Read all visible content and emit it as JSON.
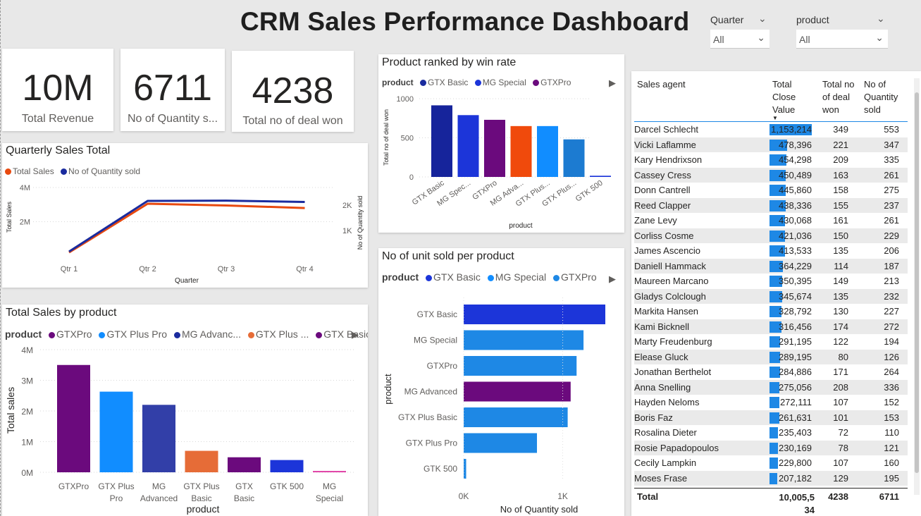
{
  "dashboard": {
    "title": "CRM Sales Performance Dashboard"
  },
  "filters": {
    "quarter": {
      "label": "Quarter",
      "value": "All"
    },
    "product": {
      "label": "product",
      "value": "All"
    }
  },
  "kpis": [
    {
      "value": "10M",
      "label": "Total Revenue"
    },
    {
      "value": "6711",
      "label": "No of Quantity s..."
    },
    {
      "value": "4238",
      "label": "Total no of deal won"
    }
  ],
  "colors": {
    "orange": "#e8490f",
    "navy": "#1a2b9e",
    "purple": "#6b0a7d",
    "blue": "#118dff",
    "darkblue": "#2337a4",
    "royal": "#1c35d9",
    "mgAdvanced": "#323fa8",
    "gtxPlusBasicOrange": "#e66c37",
    "pink": "#e044a7",
    "tableBar": "#1e88e5"
  },
  "chart_data": [
    {
      "type": "line",
      "title": "Quarterly Sales Total",
      "legend_position": "top-left",
      "x": [
        "Qtr 1",
        "Qtr 2",
        "Qtr 3",
        "Qtr 4"
      ],
      "xlabel": "Quarter",
      "ylabel": "Total Sales",
      "y2label": "No of Quantity sold",
      "yticks": [
        "2M",
        "4M"
      ],
      "y2ticks": [
        "1K",
        "2K"
      ],
      "ylim": [
        0,
        4000000
      ],
      "y2lim": [
        0,
        2700
      ],
      "series": [
        {
          "name": "Total Sales",
          "axis": "left",
          "color": "#e8490f",
          "values": [
            200000,
            3050000,
            2950000,
            2800000
          ]
        },
        {
          "name": "No of Quantity sold",
          "axis": "right",
          "color": "#1a2b9e",
          "values": [
            170,
            2170,
            2180,
            2130
          ]
        }
      ]
    },
    {
      "type": "bar",
      "title": "Product ranked by win rate",
      "legend_title": "product",
      "legend": [
        {
          "name": "GTX Basic",
          "color": "#1a2b9e"
        },
        {
          "name": "MG Special",
          "color": "#1c35d9"
        },
        {
          "name": "GTXPro",
          "color": "#6b0a7d"
        }
      ],
      "categories": [
        "GTX Basic",
        "MG Spec...",
        "GTXPro",
        "MG Adva...",
        "GTX Plus...",
        "GTX Plus...",
        "GTK 500"
      ],
      "values": [
        915,
        790,
        730,
        650,
        650,
        480,
        15
      ],
      "colors": [
        "#16249b",
        "#1c35d9",
        "#6b0a7d",
        "#f04a0c",
        "#118dff",
        "#1c7bd1",
        "#1c35d9"
      ],
      "xlabel": "product",
      "ylabel": "Total no of deal won",
      "yticks": [
        0,
        500,
        1000
      ],
      "ylim": [
        0,
        1000
      ]
    },
    {
      "type": "bar",
      "orientation": "horizontal",
      "title": "No of unit sold per product",
      "legend_title": "product",
      "legend": [
        {
          "name": "GTX Basic",
          "color": "#1c35d9"
        },
        {
          "name": "MG Special",
          "color": "#118dff"
        },
        {
          "name": "GTXPro",
          "color": "#1e88e5"
        }
      ],
      "categories": [
        "GTX Basic",
        "MG Special",
        "GTXPro",
        "MG Advanced",
        "GTX Plus Basic",
        "GTX Plus Pro",
        "GTK 500"
      ],
      "values": [
        1430,
        1210,
        1140,
        1080,
        1050,
        740,
        25
      ],
      "colors": [
        "#1c35d9",
        "#1e88e5",
        "#1e88e5",
        "#6b0a7d",
        "#1e88e5",
        "#1e88e5",
        "#1e88e5"
      ],
      "xlabel": "No of Quantity sold",
      "ylabel": "product",
      "xticks": [
        "0K",
        "1K"
      ],
      "xlim": [
        0,
        1430
      ]
    },
    {
      "type": "bar",
      "title": "Total Sales by product",
      "legend_title": "product",
      "legend": [
        {
          "name": "GTXPro",
          "color": "#6b0a7d"
        },
        {
          "name": "GTX Plus Pro",
          "color": "#118dff"
        },
        {
          "name": "MG Advanc...",
          "color": "#1a2b9e"
        },
        {
          "name": "GTX Plus ...",
          "color": "#e66c37"
        },
        {
          "name": "GTX Basic",
          "color": "#6b0a7d"
        }
      ],
      "categories": [
        "GTXPro",
        "GTX Plus Pro",
        "MG Advanced",
        "GTX Plus Basic",
        "GTX Basic",
        "GTK 500",
        "MG Special"
      ],
      "values": [
        3500000,
        2630000,
        2200000,
        700000,
        490000,
        400000,
        45000
      ],
      "colors": [
        "#6b0a7d",
        "#118dff",
        "#323fa8",
        "#e66c37",
        "#6b0a7d",
        "#1c35d9",
        "#e044a7"
      ],
      "xlabel": "product",
      "ylabel": "Total sales",
      "yticks": [
        "0M",
        "1M",
        "2M",
        "3M",
        "4M"
      ],
      "ylim": [
        0,
        4000000
      ]
    },
    {
      "type": "table",
      "columns": [
        "Sales agent",
        "Total Close Value",
        "Total no of deal won",
        "No of Quantity sold"
      ],
      "rows": [
        [
          "Darcel Schlecht",
          "1,153,214",
          "349",
          "553"
        ],
        [
          "Vicki Laflamme",
          "478,396",
          "221",
          "347"
        ],
        [
          "Kary Hendrixson",
          "454,298",
          "209",
          "335"
        ],
        [
          "Cassey Cress",
          "450,489",
          "163",
          "261"
        ],
        [
          "Donn Cantrell",
          "445,860",
          "158",
          "275"
        ],
        [
          "Reed Clapper",
          "438,336",
          "155",
          "237"
        ],
        [
          "Zane Levy",
          "430,068",
          "161",
          "261"
        ],
        [
          "Corliss Cosme",
          "421,036",
          "150",
          "229"
        ],
        [
          "James Ascencio",
          "413,533",
          "135",
          "206"
        ],
        [
          "Daniell Hammack",
          "364,229",
          "114",
          "187"
        ],
        [
          "Maureen Marcano",
          "350,395",
          "149",
          "213"
        ],
        [
          "Gladys Colclough",
          "345,674",
          "135",
          "232"
        ],
        [
          "Markita Hansen",
          "328,792",
          "130",
          "227"
        ],
        [
          "Kami Bicknell",
          "316,456",
          "174",
          "272"
        ],
        [
          "Marty Freudenburg",
          "291,195",
          "122",
          "194"
        ],
        [
          "Elease Gluck",
          "289,195",
          "80",
          "126"
        ],
        [
          "Jonathan Berthelot",
          "284,886",
          "171",
          "264"
        ],
        [
          "Anna Snelling",
          "275,056",
          "208",
          "336"
        ],
        [
          "Hayden Neloms",
          "272,111",
          "107",
          "152"
        ],
        [
          "Boris Faz",
          "261,631",
          "101",
          "153"
        ],
        [
          "Rosalina Dieter",
          "235,403",
          "72",
          "110"
        ],
        [
          "Rosie Papadopoulos",
          "230,169",
          "78",
          "121"
        ],
        [
          "Cecily Lampkin",
          "229,800",
          "107",
          "160"
        ],
        [
          "Moses Frase",
          "207,182",
          "129",
          "195"
        ]
      ],
      "total": {
        "label": "Total",
        "close_value": "10,005,5\n34",
        "deals": "4238",
        "quantity": "6711"
      },
      "close_value_max": 1153214
    }
  ]
}
